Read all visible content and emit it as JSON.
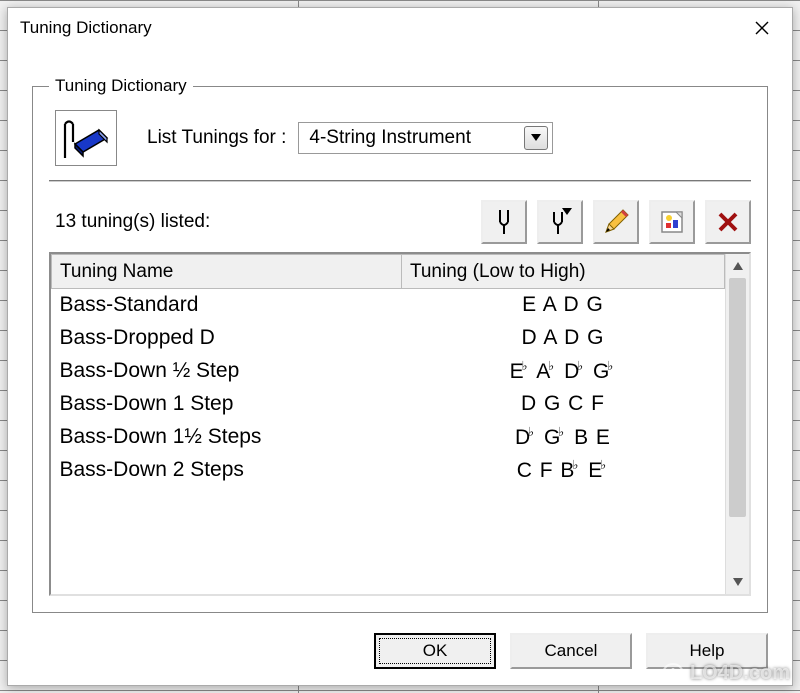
{
  "window": {
    "title": "Tuning Dictionary"
  },
  "groupbox": {
    "legend": "Tuning Dictionary",
    "list_label": "List Tunings for :",
    "instrument_selected": "4-String Instrument"
  },
  "count_label": "13 tuning(s) listed:",
  "toolbar": {
    "tool1_name": "tuning-fork-icon",
    "tool2_name": "tuning-fork-pick-icon",
    "tool3_name": "edit-pencil-icon",
    "tool4_name": "properties-icon",
    "tool5_name": "delete-x-icon"
  },
  "table": {
    "col1": "Tuning Name",
    "col2": "Tuning (Low to High)",
    "rows": [
      {
        "name": "Bass-Standard",
        "tuning": "E A D G"
      },
      {
        "name": "Bass-Dropped D",
        "tuning": "D A D G"
      },
      {
        "name": "Bass-Down ½ Step",
        "tuning": "E♭ A♭ D♭ G♭"
      },
      {
        "name": "Bass-Down 1 Step",
        "tuning": "D G C F"
      },
      {
        "name": "Bass-Down 1½ Steps",
        "tuning": "D♭ G♭ B E"
      },
      {
        "name": "Bass-Down 2 Steps",
        "tuning": "C F B♭ E♭"
      }
    ]
  },
  "buttons": {
    "ok": "OK",
    "cancel": "Cancel",
    "help": "Help"
  },
  "watermark": "LO4D.com"
}
